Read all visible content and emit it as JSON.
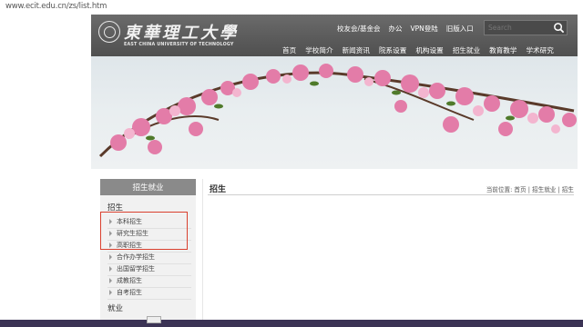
{
  "browser": {
    "url": "www.ecit.edu.cn/zs/list.htm"
  },
  "header": {
    "logo_cn": "東華理工大學",
    "logo_en": "EAST CHINA UNIVERSITY OF TECHNOLOGY",
    "top_links": [
      "校友会/基金会",
      "办公",
      "VPN登陆",
      "旧版入口"
    ],
    "search_placeholder": "Search",
    "nav": [
      "首页",
      "学校简介",
      "新闻资讯",
      "院系设置",
      "机构设置",
      "招生就业",
      "教育教学",
      "学术研究"
    ]
  },
  "sidebar": {
    "title": "招生就业",
    "category1": "招生",
    "items": [
      "本科招生",
      "研究生招生",
      "高职招生",
      "合作办学招生",
      "出国留学招生",
      "成教招生",
      "自考招生"
    ],
    "category2": "就业"
  },
  "content": {
    "title": "招生",
    "breadcrumb": "当前位置: 首页 | 招生就业 | 招生"
  },
  "colors": {
    "header_bg": "#5e5e5e",
    "sidebar_head": "#8a8a8a",
    "highlight_box": "#d9402e"
  }
}
